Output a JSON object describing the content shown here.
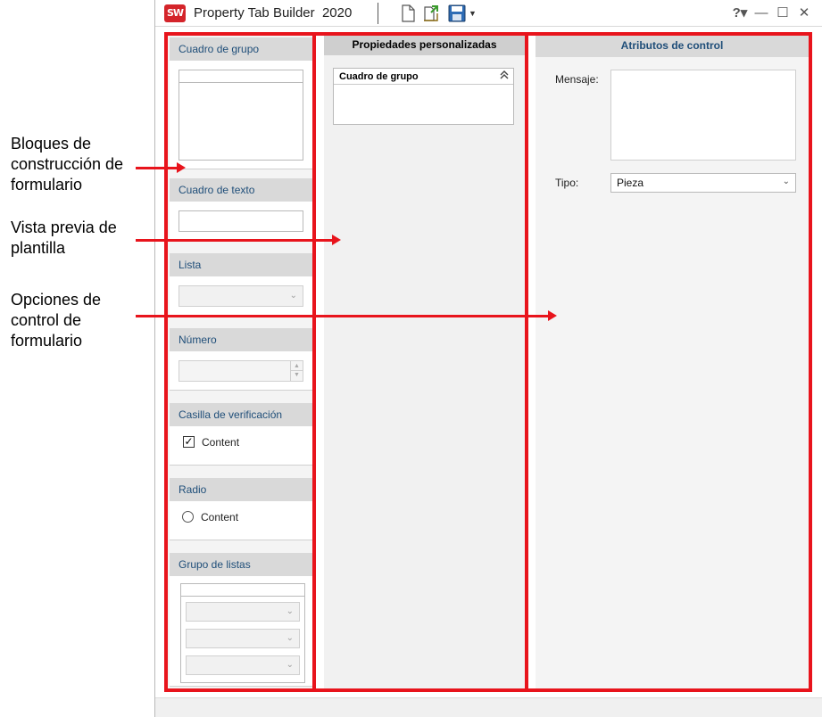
{
  "annotations": {
    "building_blocks": [
      "Bloques de",
      "construcción de",
      "formulario"
    ],
    "template_preview": [
      "Vista previa de",
      "plantilla"
    ],
    "control_options": [
      "Opciones de",
      "control de",
      "formulario"
    ]
  },
  "window": {
    "app_title": "Property Tab Builder  2020",
    "toolbar_icons": [
      "new-document-icon",
      "open-folder-icon",
      "save-icon",
      "dropdown-arrow-icon"
    ],
    "controls": {
      "help": "?▾",
      "minimize": "—",
      "maximize": "☐",
      "close": "✕"
    }
  },
  "palette": {
    "group_box": {
      "label": "Cuadro de grupo"
    },
    "text_box": {
      "label": "Cuadro de texto"
    },
    "list": {
      "label": "Lista"
    },
    "number": {
      "label": "Número"
    },
    "checkbox": {
      "label": "Casilla de verificación",
      "option": "Content",
      "checked": true
    },
    "radio": {
      "label": "Radio",
      "option": "Content"
    },
    "list_group": {
      "label": "Grupo de listas"
    }
  },
  "preview": {
    "title": "Propiedades personalizadas",
    "group": {
      "label": "Cuadro de grupo"
    }
  },
  "attributes": {
    "title": "Atributos de control",
    "message_label": "Mensaje:",
    "message_value": "",
    "type_label": "Tipo:",
    "type_value": "Pieza"
  },
  "colors": {
    "highlight_red": "#e8141c",
    "section_header_bg": "#d9d9d9",
    "section_header_text": "#1f4e79",
    "app_logo": "#d4242a"
  }
}
